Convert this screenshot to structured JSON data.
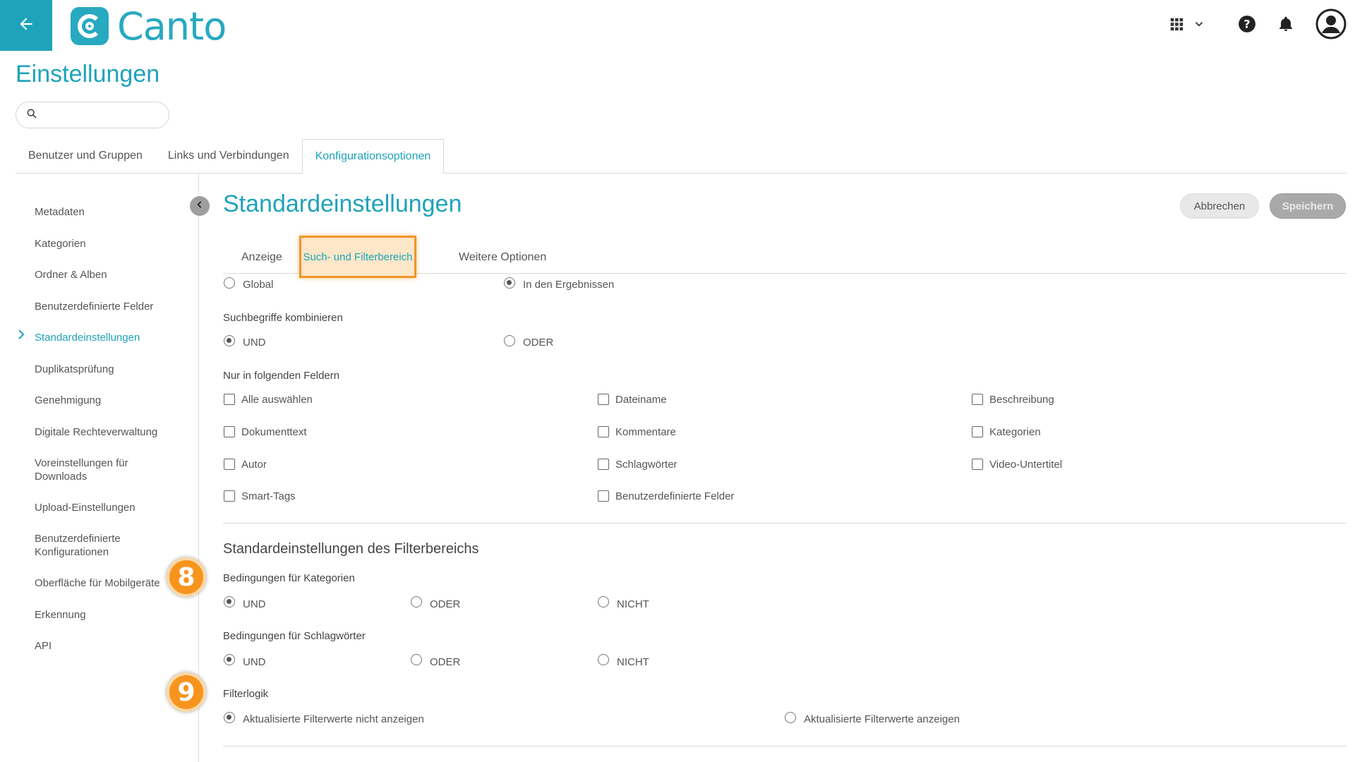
{
  "app": {
    "logo_text": "Canto",
    "brand_color": "#1ea3ba",
    "icons": [
      "back-arrow-icon",
      "apps-grid-icon",
      "chevron-down-icon",
      "help-icon",
      "bell-icon",
      "user-avatar-icon",
      "search-icon"
    ]
  },
  "page": {
    "title": "Einstellungen",
    "search_placeholder": ""
  },
  "main_tabs": [
    {
      "label": "Benutzer und Gruppen"
    },
    {
      "label": "Links und Verbindungen"
    },
    {
      "label": "Konfigurationsoptionen",
      "active": true
    }
  ],
  "sidebar": {
    "items": [
      {
        "label": "Metadaten"
      },
      {
        "label": "Kategorien"
      },
      {
        "label": "Ordner & Alben"
      },
      {
        "label": "Benutzerdefinierte Felder"
      },
      {
        "label": "Standardeinstellungen",
        "active": true
      },
      {
        "label": "Duplikatsprüfung"
      },
      {
        "label": "Genehmigung"
      },
      {
        "label": "Digitale Rechteverwaltung"
      },
      {
        "label": "Voreinstellungen für Downloads"
      },
      {
        "label": "Upload-Einstellungen"
      },
      {
        "label": "Benutzerdefinierte Konfigurationen"
      },
      {
        "label": "Oberfläche für Mobilgeräte"
      },
      {
        "label": "Erkennung"
      },
      {
        "label": "API"
      }
    ]
  },
  "content": {
    "title": "Standardeinstellungen",
    "cancel_label": "Abbrechen",
    "save_label": "Speichern",
    "sub_tabs": [
      {
        "label": "Anzeige"
      },
      {
        "label": "Such- und Filterbereich",
        "active": true
      },
      {
        "label": "Weitere Optionen"
      }
    ],
    "scope": {
      "options": [
        {
          "label": "Global",
          "selected": false
        },
        {
          "label": "In den Ergebnissen",
          "selected": true
        }
      ]
    },
    "combine": {
      "label": "Suchbegriffe kombinieren",
      "options": [
        {
          "label": "UND",
          "selected": true
        },
        {
          "label": "ODER",
          "selected": false
        }
      ]
    },
    "fields": {
      "label": "Nur in folgenden Feldern",
      "items": [
        {
          "label": "Alle auswählen",
          "checked": false
        },
        {
          "label": "Dateiname",
          "checked": false
        },
        {
          "label": "Beschreibung",
          "checked": false
        },
        {
          "label": "Dokumenttext",
          "checked": false
        },
        {
          "label": "Kommentare",
          "checked": false
        },
        {
          "label": "Kategorien",
          "checked": false
        },
        {
          "label": "Autor",
          "checked": false
        },
        {
          "label": "Schlagwörter",
          "checked": false
        },
        {
          "label": "Video-Untertitel",
          "checked": false
        },
        {
          "label": "Smart-Tags",
          "checked": false
        },
        {
          "label": "Benutzerdefinierte Felder",
          "checked": false
        }
      ]
    },
    "filter_section": {
      "heading": "Standardeinstellungen des Filterbereichs",
      "categories": {
        "label": "Bedingungen für Kategorien",
        "options": [
          {
            "label": "UND",
            "selected": true
          },
          {
            "label": "ODER",
            "selected": false
          },
          {
            "label": "NICHT",
            "selected": false
          }
        ]
      },
      "keywords": {
        "label": "Bedingungen für Schlagwörter",
        "options": [
          {
            "label": "UND",
            "selected": true
          },
          {
            "label": "ODER",
            "selected": false
          },
          {
            "label": "NICHT",
            "selected": false
          }
        ]
      },
      "logic": {
        "label": "Filterlogik",
        "options": [
          {
            "label": "Aktualisierte Filterwerte nicht anzeigen",
            "selected": true
          },
          {
            "label": "Aktualisierte Filterwerte anzeigen",
            "selected": false
          }
        ]
      }
    },
    "badges": [
      "8",
      "9"
    ]
  }
}
